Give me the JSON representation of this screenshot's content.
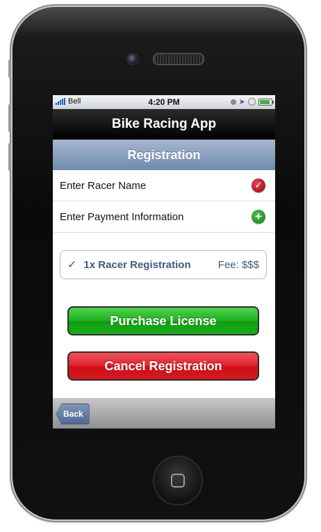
{
  "statusbar": {
    "carrier": "Bell",
    "time": "4:20 PM"
  },
  "app": {
    "title": "Bike Racing App"
  },
  "section": {
    "title": "Registration"
  },
  "rows": [
    {
      "label": "Enter Racer Name",
      "status_icon": "check-circle-icon"
    },
    {
      "label": "Enter Payment Information",
      "status_icon": "plus-circle-icon"
    }
  ],
  "summary": {
    "checkmark": "✓",
    "item": "1x Racer Registration",
    "fee": "Fee: $$$"
  },
  "buttons": {
    "purchase": "Purchase License",
    "cancel": "Cancel Registration"
  },
  "toolbar": {
    "back": "Back"
  },
  "colors": {
    "purchase": "#1fb01f",
    "cancel": "#e0202a",
    "section_header": "#6f8bad",
    "summary_text": "#3e5a86"
  }
}
